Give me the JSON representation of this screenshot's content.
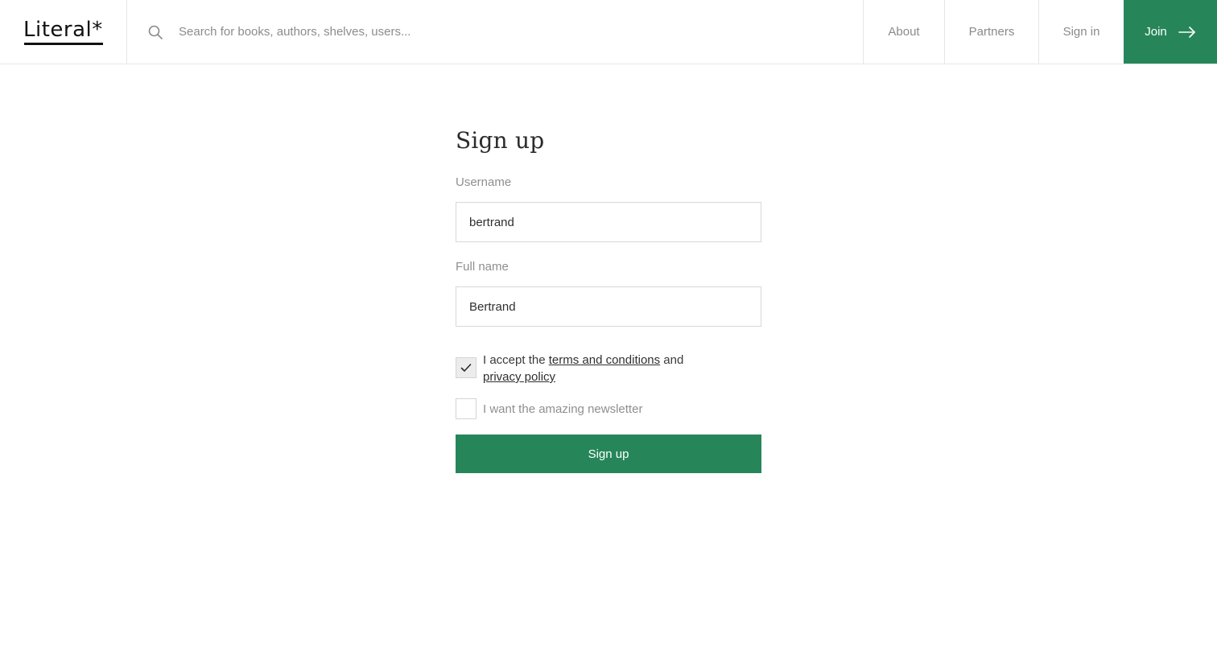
{
  "header": {
    "logo_text": "Literal*",
    "search_placeholder": "Search for books, authors, shelves, users...",
    "nav": {
      "about": "About",
      "partners": "Partners",
      "signin": "Sign in",
      "join": "Join"
    },
    "icons": {
      "search": "search-icon",
      "join_arrow": "arrow-right-icon"
    }
  },
  "form": {
    "title": "Sign up",
    "username_label": "Username",
    "username_value": "bertrand",
    "fullname_label": "Full name",
    "fullname_value": "Bertrand",
    "terms": {
      "checked": true,
      "prefix": "I accept the ",
      "terms_link": "terms and conditions",
      "middle": " and ",
      "privacy_link": "privacy policy"
    },
    "newsletter": {
      "checked": false,
      "label": "I want the amazing newsletter"
    },
    "submit_label": "Sign up"
  },
  "colors": {
    "accent": "#26865a",
    "border": "#e6e6e6",
    "muted_text": "#8f8f8f"
  }
}
